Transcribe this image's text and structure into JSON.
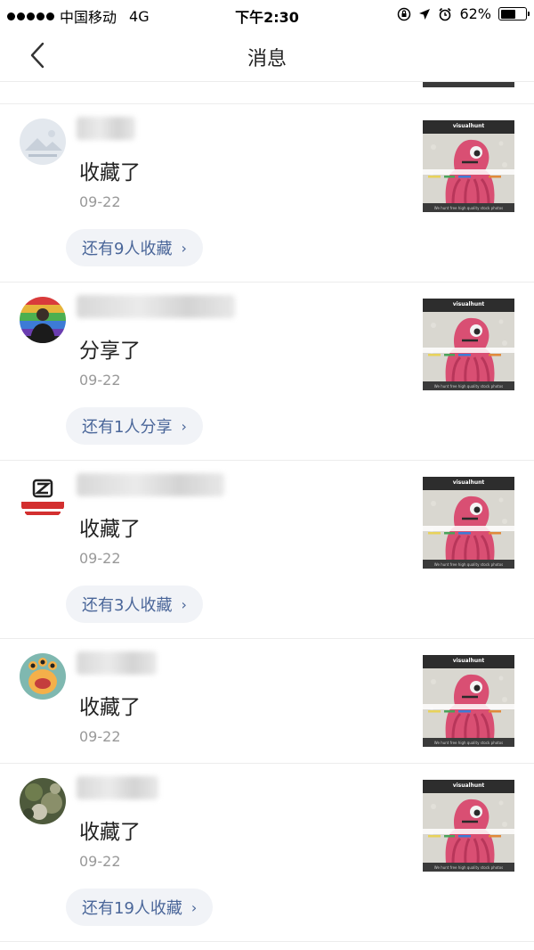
{
  "status_bar": {
    "carrier": "中国移动",
    "network": "4G",
    "time": "下午2:30",
    "battery_percent": "62%",
    "battery_level": 0.62,
    "icons": [
      "signal-dots-icon",
      "lock-rotation-icon",
      "location-arrow-icon",
      "alarm-icon",
      "battery-icon"
    ]
  },
  "nav": {
    "back_icon": "chevron-left-icon",
    "title": "消息"
  },
  "thumbnail": {
    "brand": "visualhunt",
    "caption": "We hunt free high quality stock photos"
  },
  "messages": [
    {
      "action": "收藏了",
      "date": "09-22",
      "more": "还有9人收藏",
      "avatar": "landscape-placeholder-avatar"
    },
    {
      "action": "分享了",
      "date": "09-22",
      "more": "还有1人分享",
      "avatar": "person-rainbow-avatar"
    },
    {
      "action": "收藏了",
      "date": "09-22",
      "more": "还有3人收藏",
      "avatar": "car-brand-logo-avatar"
    },
    {
      "action": "收藏了",
      "date": "09-22",
      "more": "",
      "avatar": "cartoon-monster-avatar"
    },
    {
      "action": "收藏了",
      "date": "09-22",
      "more": "还有19人收藏",
      "avatar": "nature-photo-avatar"
    }
  ],
  "colors": {
    "link": "#4a6699",
    "pill_bg": "#f1f3f7",
    "muted": "#999999",
    "divider": "#ececec"
  }
}
